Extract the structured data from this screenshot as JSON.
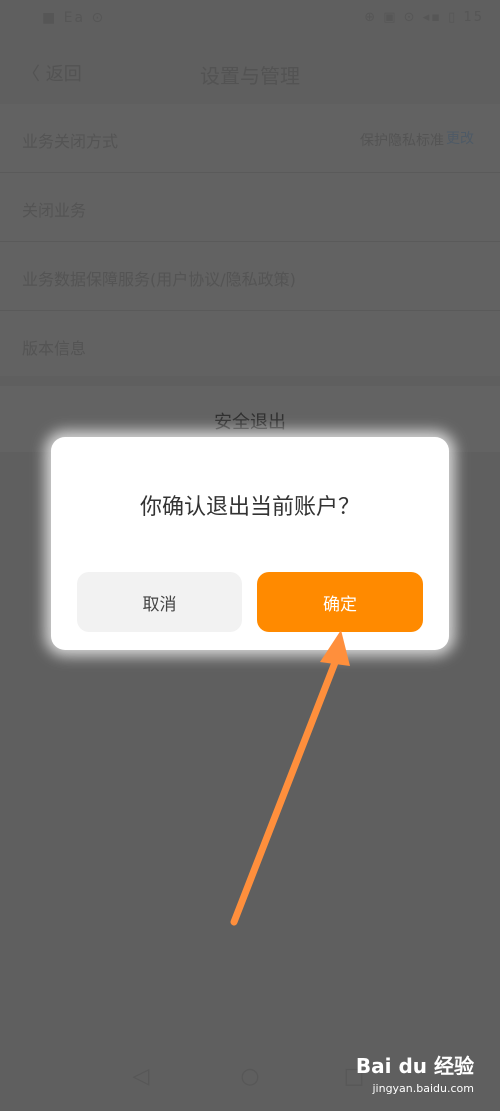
{
  "status_bar": {
    "left": "■ Ea  ⊙",
    "right": "⊕ ▣ ⊙ ◂▪ ▯ 15"
  },
  "nav": {
    "back": "〈 返回",
    "title": "设置与管理"
  },
  "settings": [
    {
      "label": "业务关闭方式",
      "value": "保护隐私标准",
      "badge": "更改"
    },
    {
      "label": "关闭业务"
    },
    {
      "label": "业务数据保障服务(用户协议/隐私政策)"
    },
    {
      "label": "版本信息"
    }
  ],
  "logout": {
    "label": "安全退出"
  },
  "dialog": {
    "message": "你确认退出当前账户？",
    "cancel": "取消",
    "confirm": "确定"
  },
  "bottom_nav": {
    "back_icon": "back-triangle-icon",
    "home_icon": "home-circle-icon",
    "recent_icon": "recent-square-icon"
  },
  "watermark": {
    "brand": "Bai du 经验",
    "url": "jingyan.baidu.com"
  },
  "colors": {
    "accent": "#ff8a00",
    "arrow": "#ff8f3c",
    "overlay": "#5f5f5f"
  }
}
